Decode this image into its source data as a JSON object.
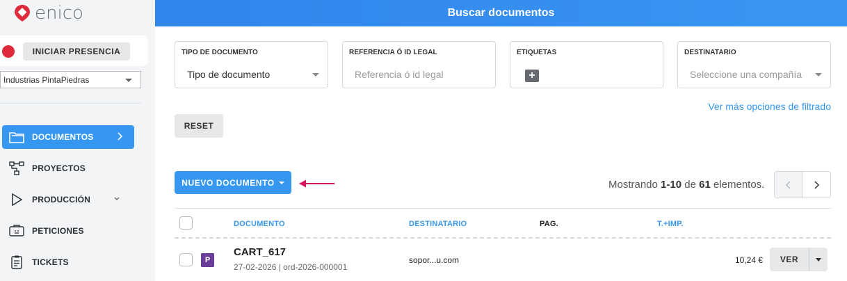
{
  "app": {
    "logo_text": "enico",
    "brand_color": "#e02b3c",
    "accent_color": "#3597f0"
  },
  "presence": {
    "button_label": "INICIAR PRESENCIA",
    "status_color": "#e02b3c"
  },
  "company_selector": {
    "selected": "Industrias PintaPiedras"
  },
  "sidebar": {
    "items": [
      {
        "label": "DOCUMENTOS",
        "icon": "folder-icon",
        "active": true
      },
      {
        "label": "PROYECTOS",
        "icon": "project-tree-icon"
      },
      {
        "label": "PRODUCCIÓN",
        "icon": "play-icon"
      },
      {
        "label": "PETICIONES",
        "icon": "requests-icon"
      },
      {
        "label": "TICKETS",
        "icon": "clipboard-icon"
      }
    ]
  },
  "header": {
    "title": "Buscar documentos"
  },
  "filters": {
    "tipo": {
      "label": "TIPO DE DOCUMENTO",
      "value": "Tipo de documento"
    },
    "referencia": {
      "label": "REFERENCIA Ó ID LEGAL",
      "placeholder": "Referencia ó id legal"
    },
    "etiquetas": {
      "label": "ETIQUETAS",
      "add_symbol": "+"
    },
    "destinatario": {
      "label": "DESTINATARIO",
      "placeholder": "Seleccione una compañía"
    },
    "more_link": "Ver más opciones de filtrado",
    "reset_label": "RESET"
  },
  "actions": {
    "new_document_label": "NUEVO DOCUMENTO"
  },
  "pagination": {
    "prefix": "Mostrando",
    "range": "1-10",
    "of": "de",
    "total": "61",
    "suffix": "elementos."
  },
  "table": {
    "columns": {
      "documento": "DOCUMENTO",
      "destinatario": "DESTINATARIO",
      "pag": "PAG.",
      "total": "T.+IMP."
    },
    "rows": [
      {
        "type_badge": "P",
        "name": "CART_617",
        "meta": "27-02-2026 | ord-2026-000001",
        "recipient": "sopor...u.com",
        "amount": "10,24 €",
        "view_label": "VER"
      }
    ]
  }
}
